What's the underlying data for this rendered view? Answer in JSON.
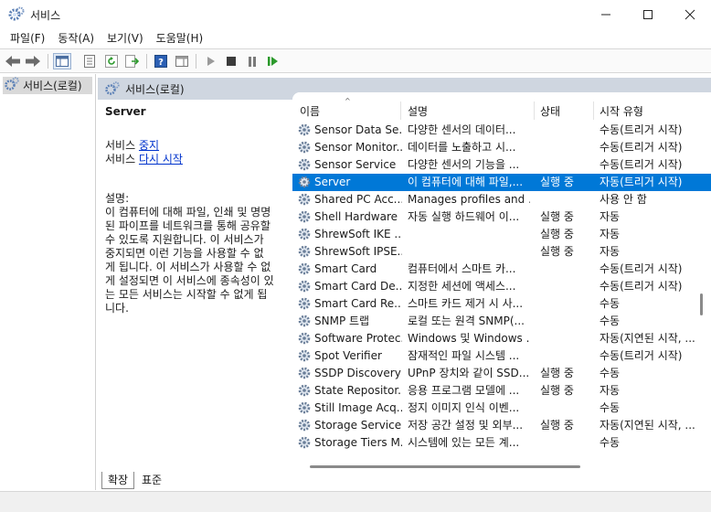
{
  "window": {
    "title": "서비스",
    "icon": "gears-icon"
  },
  "menu": [
    {
      "label": "파일(F)"
    },
    {
      "label": "동작(A)"
    },
    {
      "label": "보기(V)"
    },
    {
      "label": "도움말(H)"
    }
  ],
  "tree": {
    "root_label": "서비스(로컬)"
  },
  "pane": {
    "header_label": "서비스(로컬)"
  },
  "details": {
    "service_name": "Server",
    "service_prefix": "서비스",
    "stop_link": "중지",
    "restart_link": "다시 시작",
    "desc_label": "설명:",
    "desc_lines": [
      "이 컴퓨터에 대해 파일, 인쇄 및 명명",
      "된 파이프를 네트워크를 통해 공유할",
      "수 있도록 지원합니다. 이 서비스가",
      "중지되면 이런 기능을 사용할 수 없",
      "게 됩니다. 이 서비스가 사용할 수 없",
      "게 설정되면 이 서비스에 종속성이 있",
      "는 모든 서비스는 시작할 수 없게 됩",
      "니다."
    ]
  },
  "columns": {
    "name": "이름",
    "description": "설명",
    "status": "상태",
    "startup": "시작 유형"
  },
  "services": [
    {
      "name": "Sensor Data Se...",
      "description": "다양한 센서의 데이터...",
      "status": "",
      "startup": "수동(트리거 시작)",
      "selected": false
    },
    {
      "name": "Sensor Monitor...",
      "description": "데이터를 노출하고 시...",
      "status": "",
      "startup": "수동(트리거 시작)",
      "selected": false
    },
    {
      "name": "Sensor Service",
      "description": "다양한 센서의 기능을 ...",
      "status": "",
      "startup": "수동(트리거 시작)",
      "selected": false
    },
    {
      "name": "Server",
      "description": "이 컴퓨터에 대해 파일,...",
      "status": "실행 중",
      "startup": "자동(트리거 시작)",
      "selected": true
    },
    {
      "name": "Shared PC Acc...",
      "description": "Manages profiles and ...",
      "status": "",
      "startup": "사용 안 함",
      "selected": false
    },
    {
      "name": "Shell Hardware ...",
      "description": "자동 실행 하드웨어 이...",
      "status": "실행 중",
      "startup": "자동",
      "selected": false
    },
    {
      "name": "ShrewSoft IKE ...",
      "description": "",
      "status": "실행 중",
      "startup": "자동",
      "selected": false
    },
    {
      "name": "ShrewSoft IPSE...",
      "description": "",
      "status": "실행 중",
      "startup": "자동",
      "selected": false
    },
    {
      "name": "Smart Card",
      "description": "컴퓨터에서 스마트 카...",
      "status": "",
      "startup": "수동(트리거 시작)",
      "selected": false
    },
    {
      "name": "Smart Card De...",
      "description": "지정한 세션에 액세스...",
      "status": "",
      "startup": "수동(트리거 시작)",
      "selected": false
    },
    {
      "name": "Smart Card Re...",
      "description": "스마트 카드 제거 시 사...",
      "status": "",
      "startup": "수동",
      "selected": false
    },
    {
      "name": "SNMP 트랩",
      "description": "로컬 또는 원격 SNMP(...",
      "status": "",
      "startup": "수동",
      "selected": false
    },
    {
      "name": "Software Protec...",
      "description": "Windows 및 Windows ...",
      "status": "",
      "startup": "자동(지연된 시작, ...",
      "selected": false
    },
    {
      "name": "Spot Verifier",
      "description": "잠재적인 파일 시스템 ...",
      "status": "",
      "startup": "수동(트리거 시작)",
      "selected": false
    },
    {
      "name": "SSDP Discovery",
      "description": "UPnP 장치와 같이 SSD...",
      "status": "실행 중",
      "startup": "수동",
      "selected": false
    },
    {
      "name": "State Repositor...",
      "description": "응용 프로그램 모델에 ...",
      "status": "실행 중",
      "startup": "자동",
      "selected": false
    },
    {
      "name": "Still Image Acq...",
      "description": "정지 이미지 인식 이벤...",
      "status": "",
      "startup": "수동",
      "selected": false
    },
    {
      "name": "Storage Service",
      "description": "저장 공간 설정 및 외부...",
      "status": "실행 중",
      "startup": "자동(지연된 시작, ...",
      "selected": false
    },
    {
      "name": "Storage Tiers M...",
      "description": "시스템에 있는 모든 계...",
      "status": "",
      "startup": "수동",
      "selected": false
    }
  ],
  "tabs": [
    {
      "label": "확장",
      "active": true
    },
    {
      "label": "표준",
      "active": false
    }
  ],
  "colors": {
    "selection": "#0078d7",
    "link": "#0033cc",
    "header_band": "#cfd6e0"
  }
}
